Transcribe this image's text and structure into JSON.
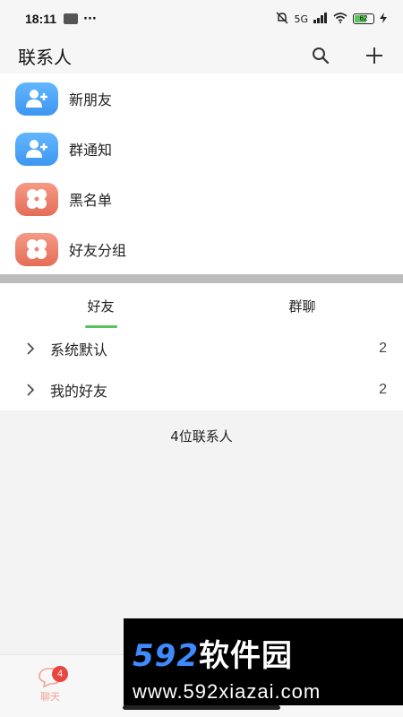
{
  "status_bar": {
    "time": "18:11",
    "extra": "···",
    "signal": "5G",
    "battery": "62"
  },
  "header": {
    "title": "联系人"
  },
  "menu": {
    "items": [
      {
        "label": "新朋友",
        "icon": "add-user-icon",
        "color": "blue"
      },
      {
        "label": "群通知",
        "icon": "add-user-icon",
        "color": "blue"
      },
      {
        "label": "黑名单",
        "icon": "clover-icon",
        "color": "red"
      },
      {
        "label": "好友分组",
        "icon": "clover-icon",
        "color": "red"
      }
    ]
  },
  "tabs": [
    {
      "label": "好友",
      "active": true
    },
    {
      "label": "群聊",
      "active": false
    }
  ],
  "groups": [
    {
      "label": "系统默认",
      "count": "2"
    },
    {
      "label": "我的好友",
      "count": "2"
    }
  ],
  "summary": "4位联系人",
  "bottom_nav": {
    "chat_label": "聊天",
    "chat_badge": "4"
  },
  "watermark": {
    "line1_num": "592",
    "line1_cn": "软件园",
    "line2": "www.592xiazai.com"
  },
  "colors": {
    "accent_green": "#59c25b",
    "blue_icon": "#3d96f0",
    "red_icon": "#e56d58",
    "badge_red": "#e8463f"
  }
}
